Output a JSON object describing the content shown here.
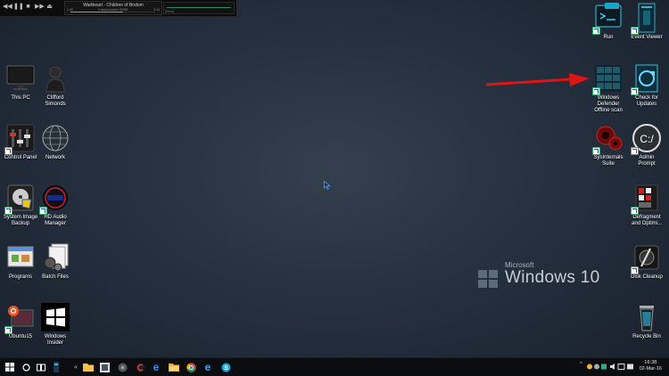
{
  "media_player": {
    "track_title": "Wartbeart - Children of Bodom",
    "track_sub": "Kakadosauber HRBB",
    "time_elapsed": "1:32",
    "time_remaining": "4:12",
    "progress": 0.62,
    "eq_tag": "[None]"
  },
  "desktop_left": [
    {
      "label": "This PC",
      "icon": "monitor-icon"
    },
    {
      "label": "Clifford\nSimonds",
      "icon": "user-icon"
    },
    {
      "label": "Control Panel",
      "icon": "control-panel-icon"
    },
    {
      "label": "Network",
      "icon": "network-globe-icon"
    },
    {
      "label": "System Image\nBackup",
      "icon": "backup-drive-icon"
    },
    {
      "label": "HD Audio\nManager",
      "icon": "audio-manager-icon"
    },
    {
      "label": "Programs",
      "icon": "programs-icon"
    },
    {
      "label": "Batch Files",
      "icon": "batch-files-icon"
    },
    {
      "label": "Ubuntu15",
      "icon": "ubuntu-icon"
    },
    {
      "label": "Windows\nInsider",
      "icon": "windows-insider-icon"
    }
  ],
  "desktop_right": [
    {
      "label": "Run",
      "icon": "run-icon"
    },
    {
      "label": "Event Viewer",
      "icon": "event-viewer-icon"
    },
    {
      "label": "Windows\nDefender\nOffline scan",
      "icon": "defender-offline-icon"
    },
    {
      "label": "Check for\nUpdates",
      "icon": "check-updates-icon"
    },
    {
      "label": "SysInternals\nSuite",
      "icon": "sysinternals-icon"
    },
    {
      "label": "Admin\nPrompt",
      "icon": "admin-prompt-icon"
    },
    {
      "label": "Defragment\nand Optimi...",
      "icon": "defragment-icon"
    },
    {
      "label": "Disk Cleanup",
      "icon": "disk-cleanup-icon"
    },
    {
      "label": "Recycle Bin",
      "icon": "recycle-bin-icon"
    }
  ],
  "watermark": {
    "microsoft": "Microsoft",
    "windows10": "Windows 10"
  },
  "taskbar": {
    "clock_time": "16:38",
    "clock_date": "02-Mar-16",
    "chevron": "^"
  },
  "colors": {
    "arrow": "#e01414",
    "accent_blue": "#1e5bb8",
    "taskbar_bg": "#0b0d10"
  }
}
